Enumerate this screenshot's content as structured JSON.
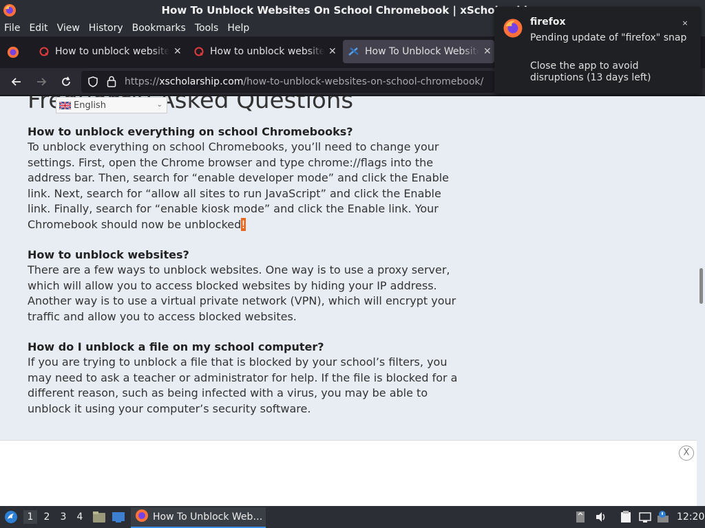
{
  "window": {
    "title": "How To Unblock Websites On School Chromebook | xScholarship –"
  },
  "menu": [
    "File",
    "Edit",
    "View",
    "History",
    "Bookmarks",
    "Tools",
    "Help"
  ],
  "tabs": [
    {
      "title": "How to unblock websites",
      "active": false
    },
    {
      "title": "How to unblock websites",
      "active": false
    },
    {
      "title": "How To Unblock Websites",
      "active": true
    }
  ],
  "url": {
    "scheme": "https://",
    "host": "xscholarship.com",
    "path": "/how-to-unblock-websites-on-school-chromebook/"
  },
  "notification": {
    "app": "firefox",
    "line1": "Pending update of \"firefox\" snap",
    "line2": "Close the app to avoid disruptions (13 days left)",
    "close": "×"
  },
  "page": {
    "cut_heading": "Frequently Asked Questions",
    "language": "English",
    "qa": [
      {
        "question": "How to unblock everything on school Chromebooks?",
        "answer": "To unblock everything on school Chromebooks, you’ll need to change your settings. First, open the Chrome browser and type chrome://flags into the address bar. Then, search for “enable developer mode” and click the Enable link. Next, search for “allow all sites to run JavaScript” and click the Enable link. Finally, search for “enable kiosk mode” and click the Enable link. Your Chromebook should now be unblocked",
        "answer_tail": "!"
      },
      {
        "question": "How to unblock websites?",
        "answer": "There are a few ways to unblock websites. One way is to use a proxy server, which will allow you to access blocked websites by hiding your IP address. Another way is to use a virtual private network (VPN), which will encrypt your traffic and allow you to access blocked websites.",
        "answer_tail": ""
      },
      {
        "question": "How do I unblock a file on my school computer?",
        "answer": "If you are trying to unblock a file that is blocked by your school’s filters, you may need to ask a teacher or administrator for help. If the file is blocked for a different reason, such as being infected with a virus, you may be able to unblock it using your computer’s security software.",
        "answer_tail": ""
      }
    ],
    "ad_close": "X"
  },
  "taskbar": {
    "workspaces": [
      "1",
      "2",
      "3",
      "4"
    ],
    "active_workspace": "1",
    "task_label": "How To Unblock Web…",
    "clock": "12:20"
  },
  "icons": {
    "browser": "firefox-icon",
    "tab_favicon_1": "red-q-favicon",
    "tab_favicon_3": "xscholarship-favicon",
    "back": "back-arrow-icon",
    "forward": "forward-arrow-icon",
    "reload": "reload-icon",
    "shield": "tracking-shield-icon",
    "lock": "lock-icon"
  },
  "colors": {
    "accent": "#3d8ee6",
    "highlight": "#e8671f",
    "page_bg": "#e8edf4"
  }
}
